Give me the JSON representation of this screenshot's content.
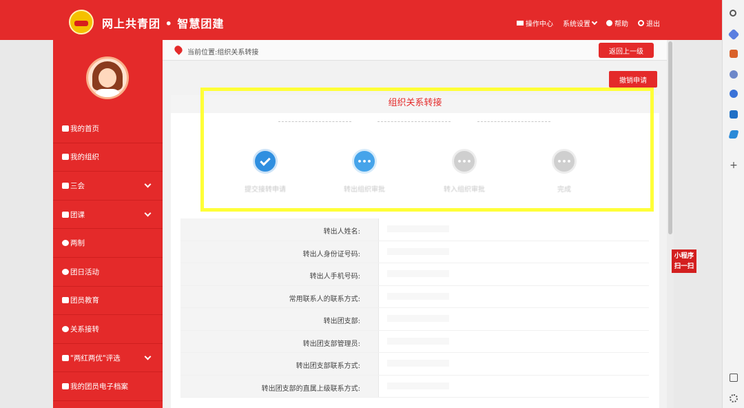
{
  "header": {
    "brand": "网上共青团 • 智慧团建",
    "nav": [
      {
        "label": "操作中心",
        "icon": "mail-icon"
      },
      {
        "label": "系统设置",
        "icon": "chevron-down-icon"
      },
      {
        "label": "帮助",
        "icon": "help-icon"
      },
      {
        "label": "退出",
        "icon": "power-icon"
      }
    ]
  },
  "sidebar": {
    "items": [
      {
        "label": "我的首页",
        "icon": "home-icon",
        "expandable": false
      },
      {
        "label": "我的组织",
        "icon": "group-icon",
        "expandable": false
      },
      {
        "label": "三会",
        "icon": "edit-icon",
        "expandable": true
      },
      {
        "label": "团课",
        "icon": "folder-icon",
        "expandable": true
      },
      {
        "label": "两制",
        "icon": "target-icon",
        "expandable": false
      },
      {
        "label": "团日活动",
        "icon": "recycle-icon",
        "expandable": false
      },
      {
        "label": "团员教育",
        "icon": "graduation-cap-icon",
        "expandable": false
      },
      {
        "label": "关系接转",
        "icon": "refresh-icon",
        "expandable": false
      },
      {
        "label": "\"两红两优\"评选",
        "icon": "edit-icon",
        "expandable": true
      },
      {
        "label": "我的团员电子档案",
        "icon": "file-icon",
        "expandable": false
      }
    ]
  },
  "breadcrumb": {
    "text": "当前位置:组织关系转接"
  },
  "buttons": {
    "back": "返回上一级",
    "cancel": "撤销申请"
  },
  "card": {
    "title": "组织关系转接"
  },
  "steps": [
    {
      "label": "提交接转申请",
      "state": "done"
    },
    {
      "label": "转出组织审批",
      "state": "current"
    },
    {
      "label": "转入组织审批",
      "state": "pending"
    },
    {
      "label": "完成",
      "state": "pending"
    }
  ],
  "form": {
    "rows": [
      {
        "label": "转出人姓名:"
      },
      {
        "label": "转出人身份证号码:"
      },
      {
        "label": "转出人手机号码:"
      },
      {
        "label": "常用联系人的联系方式:"
      },
      {
        "label": "转出团支部:"
      },
      {
        "label": "转出团支部管理员:"
      },
      {
        "label": "转出团支部联系方式:"
      },
      {
        "label": "转出团支部的直属上级联系方式:"
      }
    ]
  },
  "floating": {
    "line1": "小程序",
    "line2": "扫一扫"
  },
  "colors": {
    "brand_red": "#e42a2a",
    "highlight": "#ffff38",
    "step_done": "#2f8fe0",
    "step_pending": "#cfcfcf"
  }
}
